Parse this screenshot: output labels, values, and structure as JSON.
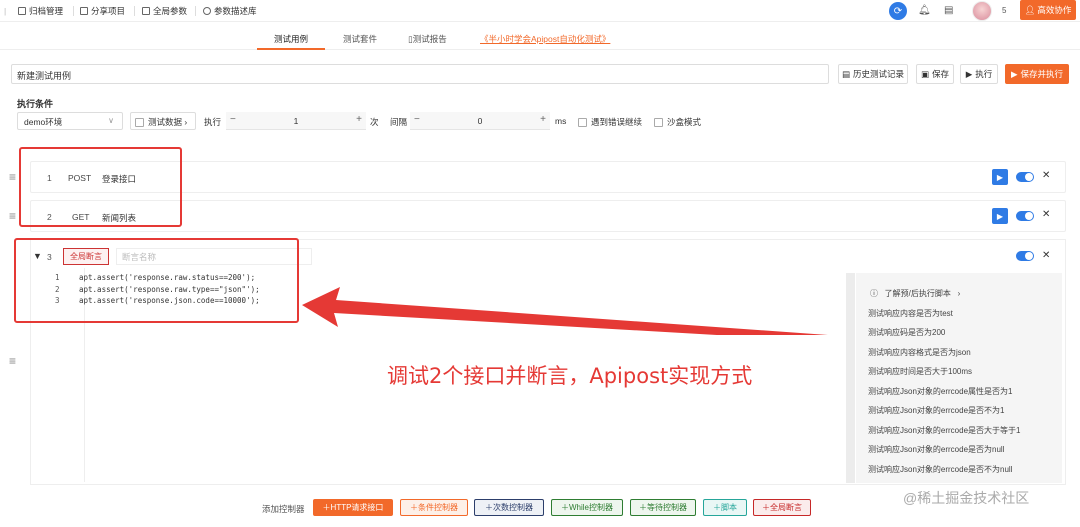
{
  "topbar": {
    "items": [
      {
        "icon": "box-icon",
        "label": "归档管理"
      },
      {
        "icon": "share-icon",
        "label": "分享项目"
      },
      {
        "icon": "grid-icon",
        "label": "全局参数"
      },
      {
        "icon": "cube-icon",
        "label": "参数描述库"
      }
    ],
    "user_count": "5",
    "collab_label": "高效协作"
  },
  "tabs": [
    {
      "label": "测试用例",
      "active": true
    },
    {
      "label": "测试套件",
      "active": false
    },
    {
      "label": "测试报告",
      "active": false
    }
  ],
  "tab_link": "《半小时学会Apipost自动化测试》",
  "case_name": "新建测试用例",
  "actions": {
    "history": "历史测试记录",
    "save": "保存",
    "run": "执行",
    "save_run": "保存并执行"
  },
  "exec": {
    "title": "执行条件",
    "env": "demo环境",
    "test_data": "测试数据",
    "run_label": "执行",
    "run_count": "1",
    "times": "次",
    "interval_label": "间隔",
    "interval": "0",
    "ms": "ms",
    "continue_on_error": "遇到错误继续",
    "sandbox": "沙盒模式"
  },
  "steps": [
    {
      "num": "1",
      "method": "POST",
      "name": "登录接口"
    },
    {
      "num": "2",
      "method": "GET",
      "name": "新闻列表"
    }
  ],
  "assertion": {
    "num": "3",
    "badge": "全局断言",
    "name_placeholder": "断言名称",
    "code": [
      {
        "ln": "1",
        "text": "apt.assert('response.raw.status==200');"
      },
      {
        "ln": "2",
        "text": "apt.assert('response.raw.type==\"json\"');"
      },
      {
        "ln": "3",
        "text": "apt.assert('response.json.code==10000');"
      }
    ]
  },
  "snippets": {
    "header": "了解预/后执行脚本",
    "items": [
      "测试响应内容是否为test",
      "测试响应码是否为200",
      "测试响应内容格式是否为json",
      "测试响应时间是否大于100ms",
      "测试响应Json对象的errcode属性是否为1",
      "测试响应Json对象的errcode是否不为1",
      "测试响应Json对象的errcode是否大于等于1",
      "测试响应Json对象的errcode是否为null",
      "测试响应Json对象的errcode是否不为null"
    ]
  },
  "annotation": "调试2个接口并断言，Apipost实现方式",
  "controllers": {
    "label": "添加控制器",
    "buttons": [
      {
        "label": "＋HTTP请求接口",
        "color": "#f2692a"
      },
      {
        "label": "＋条件控制器",
        "color": "#f2692a"
      },
      {
        "label": "＋次数控制器",
        "color": "#2c3e6b"
      },
      {
        "label": "＋While控制器",
        "color": "#2e7d32"
      },
      {
        "label": "＋等待控制器",
        "color": "#2e7d32"
      },
      {
        "label": "＋脚本",
        "color": "#26a69a"
      },
      {
        "label": "＋全局断言",
        "color": "#c62828"
      }
    ]
  },
  "watermark": "@稀土掘金技术社区"
}
